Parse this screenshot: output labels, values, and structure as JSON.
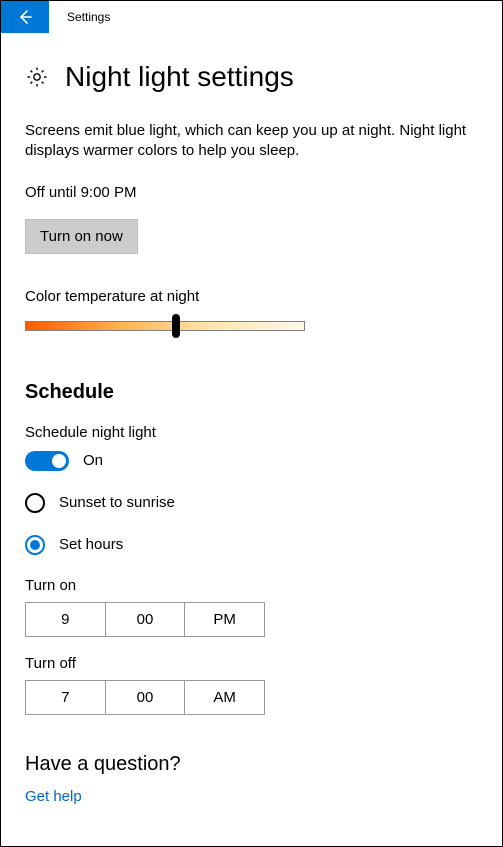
{
  "window": {
    "title": "Settings"
  },
  "page": {
    "title": "Night light settings",
    "description": "Screens emit blue light, which can keep you up at night. Night light displays warmer colors to help you sleep.",
    "status": "Off until 9:00 PM",
    "turn_on_label": "Turn on now",
    "color_temp_label": "Color temperature at night"
  },
  "schedule": {
    "heading": "Schedule",
    "toggle_label": "Schedule night light",
    "toggle_state": "On",
    "options": {
      "sunset": "Sunset to sunrise",
      "set_hours": "Set hours"
    },
    "turn_on_label": "Turn on",
    "turn_on": {
      "hour": "9",
      "minute": "00",
      "period": "PM"
    },
    "turn_off_label": "Turn off",
    "turn_off": {
      "hour": "7",
      "minute": "00",
      "period": "AM"
    }
  },
  "help": {
    "heading": "Have a question?",
    "link": "Get help"
  }
}
